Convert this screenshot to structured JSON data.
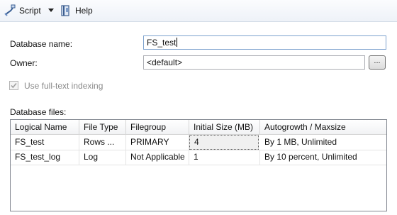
{
  "toolbar": {
    "script_label": "Script",
    "help_label": "Help",
    "icons": [
      "script-icon",
      "chevron-down-icon",
      "help-icon"
    ]
  },
  "form": {
    "database_name_label": "Database name:",
    "database_name_value": "FS_test",
    "owner_label": "Owner:",
    "owner_value": "<default>",
    "browse_label": "...",
    "fulltext_label": "Use full-text indexing",
    "fulltext_checked": true,
    "fulltext_enabled": false
  },
  "database_files": {
    "label": "Database files:",
    "columns": [
      "Logical Name",
      "File Type",
      "Filegroup",
      "Initial Size (MB)",
      "Autogrowth / Maxsize"
    ],
    "rows": [
      [
        "FS_test",
        "Rows ...",
        "PRIMARY",
        "4",
        "By 1 MB, Unlimited"
      ],
      [
        "FS_test_log",
        "Log",
        "Not Applicable",
        "1",
        "By 10 percent, Unlimited"
      ]
    ]
  }
}
